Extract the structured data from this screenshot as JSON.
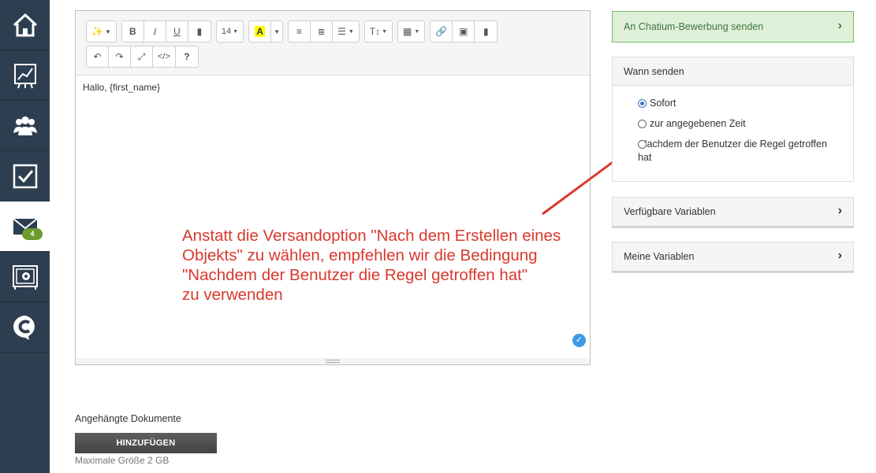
{
  "sidebar": {
    "items": [
      {
        "name": "home-icon"
      },
      {
        "name": "chart-icon"
      },
      {
        "name": "users-icon"
      },
      {
        "name": "checkbox-icon"
      },
      {
        "name": "mail-icon",
        "badge": "4",
        "active": true
      },
      {
        "name": "safe-icon"
      },
      {
        "name": "chatium-logo-icon"
      }
    ]
  },
  "editor": {
    "toolbar": {
      "font_size": "14",
      "highlight_letter": "A",
      "bold": "B",
      "italic": "I",
      "underline": "U",
      "code": "</>",
      "help": "?"
    },
    "content": "Hallo, {first_name}"
  },
  "annotation": {
    "text": "Anstatt die Versandoption \"Nach dem Erstellen eines\nObjekts\" zu wählen, empfehlen wir die Bedingung\n\"Nachdem der Benutzer die Regel getroffen hat\"\nzu verwenden",
    "color": "#d9382c"
  },
  "attachments": {
    "label": "Angehängte Dokumente",
    "button": "HINZUFÜGEN",
    "max_size": "Maximale Größe 2 GB"
  },
  "right_panel": {
    "send_link": "An Chatium-Bewerbung senden",
    "when_to_send": {
      "title": "Wann senden",
      "options": [
        {
          "label": "Sofort",
          "checked": true
        },
        {
          "label": "zur angegebenen Zeit",
          "checked": false
        },
        {
          "label": "Nachdem der Benutzer die Regel getroffen hat",
          "checked": false
        }
      ]
    },
    "available_variables": "Verfügbare Variablen",
    "my_variables": "Meine Variablen"
  }
}
